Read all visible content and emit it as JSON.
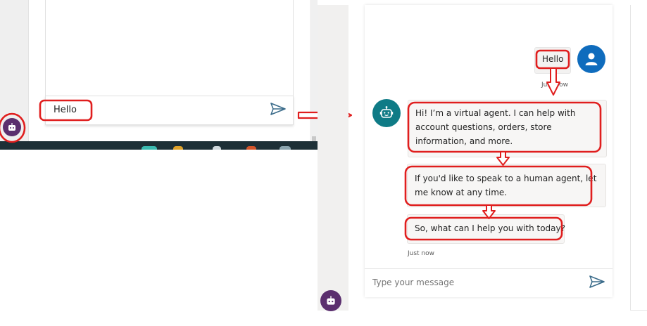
{
  "before": {
    "input_value": "Hello"
  },
  "after": {
    "user_message": "Hello",
    "user_timestamp": "Just now",
    "bot_messages": [
      "Hi! I’m a virtual agent. I can help with account questions, orders, store information, and more.",
      "If you'd like to speak to a human agent, let me know at any time.",
      "So, what can I help you with today?"
    ],
    "bot_timestamp": "Just now",
    "input_placeholder": "Type your message"
  },
  "colors": {
    "annotation_red": "#e01e1e",
    "bot_avatar": "#0f7b86",
    "user_avatar": "#0f6cbd",
    "launcher": "#5b2f6e",
    "send_icon": "#3a6b8a"
  },
  "icons": [
    "send-icon",
    "bot-icon",
    "user-icon",
    "bot-launcher-icon",
    "arrow-right-icon"
  ]
}
